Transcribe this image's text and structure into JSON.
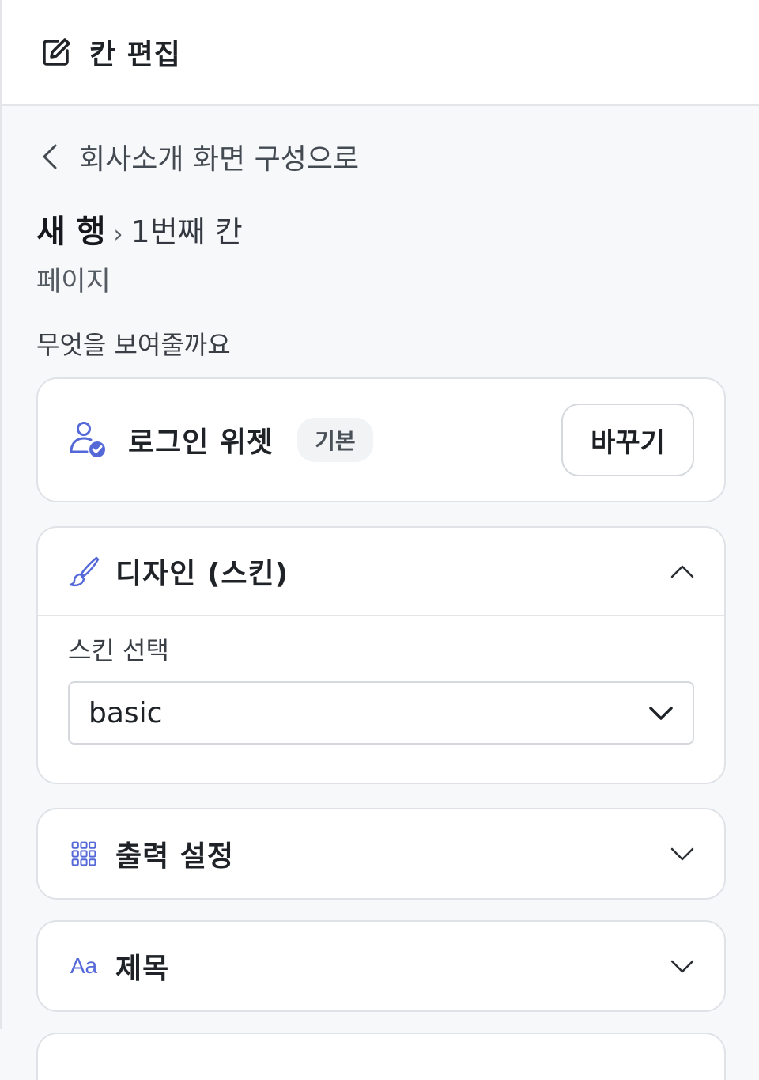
{
  "header": {
    "title": "칸 편집",
    "icon": "edit-icon"
  },
  "back": {
    "label": "회사소개 화면 구성으로"
  },
  "breadcrumb": {
    "row": "새 행",
    "separator": "›",
    "cell": "1번째 칸"
  },
  "page_label": "페이지",
  "what_label": "무엇을 보여줄까요",
  "widget": {
    "name": "로그인 위젯",
    "badge": "기본",
    "change_label": "바꾸기",
    "icon": "user-check-icon"
  },
  "sections": {
    "design": {
      "label": "디자인 (스킨)",
      "icon": "brush-icon",
      "expanded": true,
      "skin_label": "스킨 선택",
      "skin_value": "basic"
    },
    "output": {
      "label": "출력 설정",
      "icon": "grid-icon",
      "expanded": false
    },
    "title": {
      "label": "제목",
      "icon_text": "Aa",
      "expanded": false
    }
  },
  "colors": {
    "accent": "#5468d8",
    "border": "#dfe2e6"
  }
}
